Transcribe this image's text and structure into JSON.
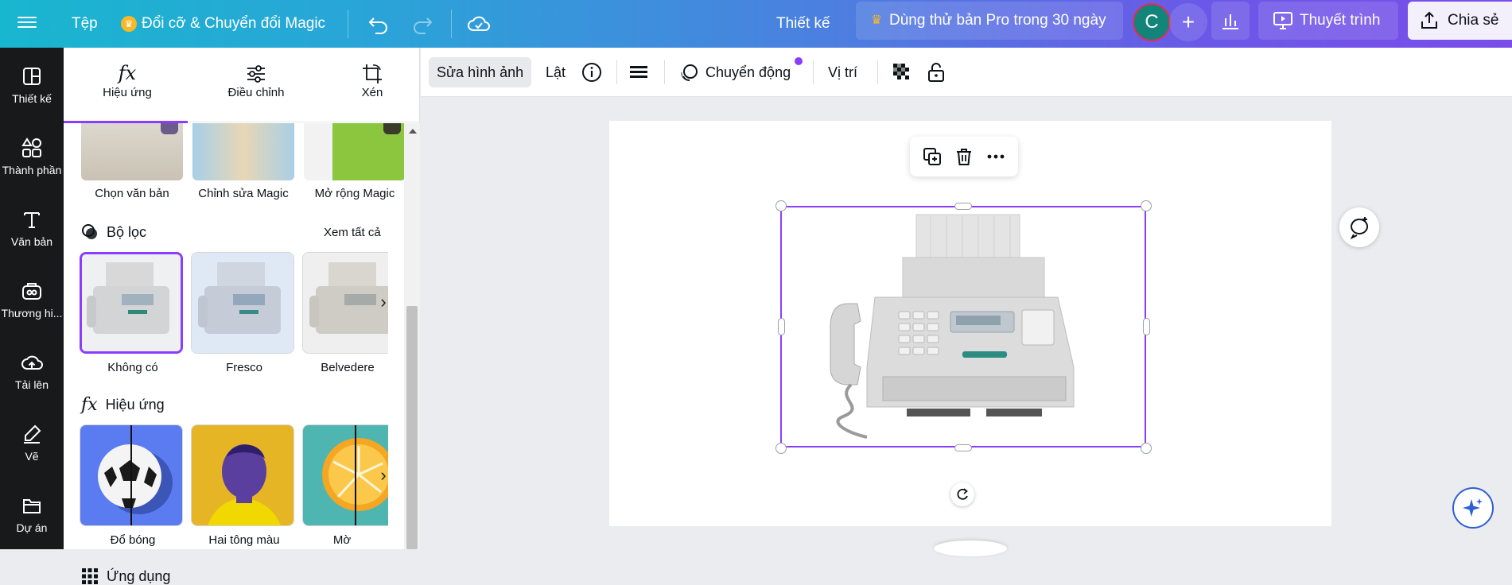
{
  "topbar": {
    "file": "Tệp",
    "magic_resize": "Đổi cỡ & Chuyển đổi Magic",
    "design": "Thiết kế",
    "pro_trial": "Dùng thử bản Pro trong 30 ngày",
    "avatar_letter": "C",
    "present": "Thuyết trình",
    "share": "Chia sẻ"
  },
  "rail": {
    "items": [
      {
        "label": "Thiết kế",
        "icon": "layout-icon"
      },
      {
        "label": "Thành phần",
        "icon": "elements-icon"
      },
      {
        "label": "Văn bản",
        "icon": "text-icon"
      },
      {
        "label": "Thương hi...",
        "icon": "brand-icon"
      },
      {
        "label": "Tải lên",
        "icon": "upload-icon"
      },
      {
        "label": "Vẽ",
        "icon": "draw-icon"
      },
      {
        "label": "Dự án",
        "icon": "folder-icon"
      }
    ]
  },
  "panel": {
    "tabs": [
      {
        "label": "Hiệu ứng",
        "icon": "fx-icon"
      },
      {
        "label": "Điều chỉnh",
        "icon": "sliders-icon"
      },
      {
        "label": "Xén",
        "icon": "crop-icon"
      }
    ],
    "top_tools": [
      "Chọn văn bản",
      "Chỉnh sửa Magic",
      "Mở rộng Magic"
    ],
    "filters": {
      "title": "Bộ lọc",
      "see_all": "Xem tất cả",
      "items": [
        "Không có",
        "Fresco",
        "Belvedere"
      ]
    },
    "effects": {
      "title": "Hiệu ứng",
      "items": [
        "Đổ bóng",
        "Hai tông màu",
        "Mờ"
      ]
    },
    "apps": {
      "title": "Ứng dụng"
    }
  },
  "context_toolbar": {
    "edit_image": "Sửa hình ảnh",
    "flip": "Lật",
    "animate": "Chuyển động",
    "position": "Vị trí"
  },
  "colors": {
    "accent": "#8b3dff",
    "rail_bg": "#18191b",
    "canvas_bg": "#ebecf0"
  }
}
